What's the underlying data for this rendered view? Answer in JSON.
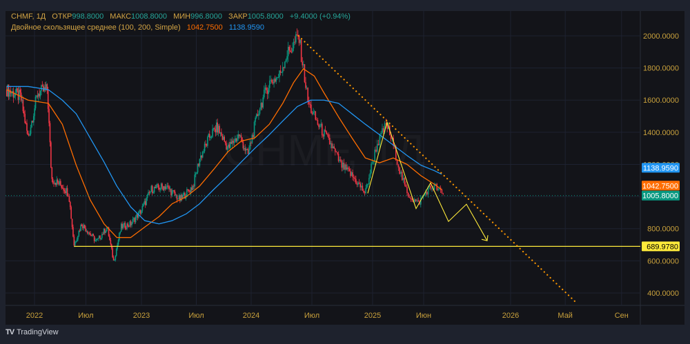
{
  "header": {
    "symbol": "CHMF, 1Д",
    "open_label": "ОТКР",
    "open": "998.8000",
    "high_label": "МАКС",
    "high": "1008.8000",
    "low_label": "МИН",
    "low": "996.8000",
    "close_label": "ЗАКР",
    "close": "1005.8000",
    "change": "+9.4000 (+0.94%)",
    "indicator": "Двойное скользящее среднее (100, 200, Simple)",
    "ma_fast_value": "1042.7500",
    "ma_slow_value": "1138.9590"
  },
  "watermark": "CHMF, 1Д",
  "footer": {
    "brand": "TradingView"
  },
  "colors": {
    "up": "#089981",
    "down": "#f23645",
    "ma_fast": "#ff6d00",
    "ma_slow": "#2196f3",
    "drawing": "#ffeb3b",
    "trend": "#ff9800",
    "axis_text": "#c9a13c"
  },
  "chart_data": {
    "type": "candlestick",
    "title": "CHMF, 1Д",
    "ylim": [
      300,
      2100
    ],
    "y_ticks": [
      "400.0000",
      "600.0000",
      "800.0000",
      "1000.0000",
      "1200.0000",
      "1400.0000",
      "1600.0000",
      "1800.0000",
      "2000.0000"
    ],
    "y_tick_values": [
      400,
      600,
      800,
      1000,
      1200,
      1400,
      1600,
      1800,
      2000
    ],
    "x_ticks": [
      {
        "label": "2022",
        "t": 2022.0
      },
      {
        "label": "Июл",
        "t": 2022.48
      },
      {
        "label": "2023",
        "t": 2023.0
      },
      {
        "label": "Июл",
        "t": 2023.5
      },
      {
        "label": "2024",
        "t": 2024.0
      },
      {
        "label": "Июл",
        "t": 2024.5
      },
      {
        "label": "2025",
        "t": 2025.0
      },
      {
        "label": "Июн",
        "t": 2025.37
      },
      {
        "label": "2026",
        "t": 2026.0
      },
      {
        "label": "Май",
        "t": 2026.33
      },
      {
        "label": "Сен",
        "t": 2026.67
      }
    ],
    "price_path": [
      [
        2021.74,
        1665
      ],
      [
        2021.87,
        1620
      ],
      [
        2021.94,
        1365
      ],
      [
        2022.03,
        1645
      ],
      [
        2022.12,
        1665
      ],
      [
        2022.16,
        1110
      ],
      [
        2022.26,
        1065
      ],
      [
        2022.32,
        1020
      ],
      [
        2022.37,
        700
      ],
      [
        2022.44,
        830
      ],
      [
        2022.58,
        720
      ],
      [
        2022.68,
        810
      ],
      [
        2022.74,
        595
      ],
      [
        2022.81,
        810
      ],
      [
        2022.9,
        830
      ],
      [
        2023.0,
        915
      ],
      [
        2023.09,
        1045
      ],
      [
        2023.22,
        1065
      ],
      [
        2023.35,
        980
      ],
      [
        2023.47,
        1065
      ],
      [
        2023.53,
        1235
      ],
      [
        2023.63,
        1385
      ],
      [
        2023.69,
        1430
      ],
      [
        2023.79,
        1300
      ],
      [
        2023.89,
        1385
      ],
      [
        2023.97,
        1255
      ],
      [
        2024.06,
        1535
      ],
      [
        2024.15,
        1710
      ],
      [
        2024.23,
        1750
      ],
      [
        2024.29,
        1880
      ],
      [
        2024.35,
        1945
      ],
      [
        2024.39,
        2000
      ],
      [
        2024.43,
        1795
      ],
      [
        2024.47,
        1580
      ],
      [
        2024.55,
        1450
      ],
      [
        2024.66,
        1320
      ],
      [
        2024.74,
        1195
      ],
      [
        2024.83,
        1130
      ],
      [
        2024.94,
        1020
      ],
      [
        2025.03,
        1320
      ],
      [
        2025.1,
        1450
      ],
      [
        2025.15,
        1320
      ],
      [
        2025.2,
        1150
      ],
      [
        2025.25,
        1020
      ],
      [
        2025.33,
        955
      ],
      [
        2025.4,
        1045
      ],
      [
        2025.45,
        1065
      ],
      [
        2025.52,
        1005.8
      ]
    ],
    "series": [
      {
        "name": "MA 100",
        "value": "1042.7500",
        "points": [
          [
            2021.74,
            1665
          ],
          [
            2021.94,
            1600
          ],
          [
            2022.13,
            1580
          ],
          [
            2022.26,
            1450
          ],
          [
            2022.39,
            1195
          ],
          [
            2022.52,
            980
          ],
          [
            2022.65,
            830
          ],
          [
            2022.77,
            745
          ],
          [
            2022.9,
            745
          ],
          [
            2023.03,
            810
          ],
          [
            2023.16,
            875
          ],
          [
            2023.28,
            955
          ],
          [
            2023.41,
            1000
          ],
          [
            2023.53,
            1065
          ],
          [
            2023.66,
            1170
          ],
          [
            2023.79,
            1280
          ],
          [
            2023.91,
            1345
          ],
          [
            2024.03,
            1365
          ],
          [
            2024.15,
            1450
          ],
          [
            2024.26,
            1580
          ],
          [
            2024.35,
            1710
          ],
          [
            2024.43,
            1795
          ],
          [
            2024.52,
            1750
          ],
          [
            2024.6,
            1645
          ],
          [
            2024.72,
            1495
          ],
          [
            2024.83,
            1365
          ],
          [
            2024.94,
            1240
          ],
          [
            2025.05,
            1210
          ],
          [
            2025.15,
            1240
          ],
          [
            2025.25,
            1200
          ],
          [
            2025.35,
            1130
          ],
          [
            2025.45,
            1075
          ],
          [
            2025.5,
            1042.75
          ]
        ]
      },
      {
        "name": "MA 200",
        "value": "1138.9590",
        "points": [
          [
            2021.74,
            1685
          ],
          [
            2021.94,
            1685
          ],
          [
            2022.13,
            1665
          ],
          [
            2022.26,
            1600
          ],
          [
            2022.39,
            1515
          ],
          [
            2022.52,
            1365
          ],
          [
            2022.65,
            1215
          ],
          [
            2022.77,
            1065
          ],
          [
            2022.9,
            935
          ],
          [
            2023.03,
            850
          ],
          [
            2023.16,
            830
          ],
          [
            2023.28,
            850
          ],
          [
            2023.41,
            893
          ],
          [
            2023.53,
            955
          ],
          [
            2023.66,
            1045
          ],
          [
            2023.79,
            1130
          ],
          [
            2023.91,
            1215
          ],
          [
            2024.03,
            1300
          ],
          [
            2024.15,
            1385
          ],
          [
            2024.26,
            1470
          ],
          [
            2024.38,
            1560
          ],
          [
            2024.49,
            1600
          ],
          [
            2024.6,
            1600
          ],
          [
            2024.72,
            1580
          ],
          [
            2024.83,
            1515
          ],
          [
            2024.94,
            1450
          ],
          [
            2025.05,
            1385
          ],
          [
            2025.15,
            1320
          ],
          [
            2025.25,
            1255
          ],
          [
            2025.35,
            1195
          ],
          [
            2025.45,
            1160
          ],
          [
            2025.5,
            1138.959
          ]
        ]
      }
    ],
    "last_price": "1005.8000",
    "last_price_value": 1005.8,
    "horizontal_level": {
      "value": 689.978,
      "label": "689.9780",
      "start_t": 2022.37
    },
    "trendline": [
      [
        2024.39,
        2000
      ],
      [
        2026.4,
        336
      ]
    ],
    "zigzag": [
      [
        2024.96,
        1020
      ],
      [
        2025.105,
        1462
      ],
      [
        2025.315,
        925
      ],
      [
        2025.42,
        1085
      ],
      [
        2025.55,
        845
      ],
      [
        2025.68,
        952
      ],
      [
        2025.83,
        725
      ]
    ]
  }
}
